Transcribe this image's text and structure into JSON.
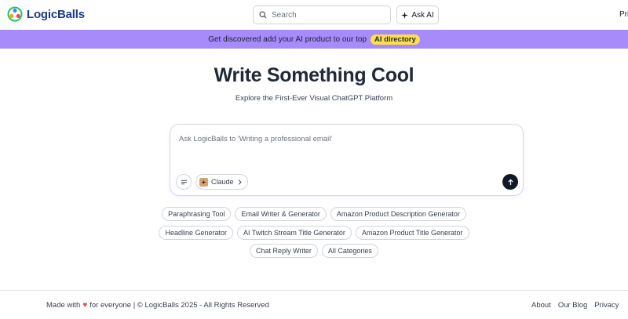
{
  "header": {
    "logo_text": "LogicBalls",
    "search_placeholder": "Search",
    "ask_ai_label": "Ask AI",
    "nav_cut_label": "Pri"
  },
  "banner": {
    "text": "Get discovered add your AI product to our top",
    "badge": "AI directory",
    "bg_color": "#a78bfa",
    "badge_color": "#fde047"
  },
  "hero": {
    "title": "Write Something Cool",
    "subtitle": "Explore the First-Ever Visual ChatGPT Platform"
  },
  "prompt": {
    "placeholder": "Ask LogicBalls to 'Writing a professional email'",
    "model_label": "Claude",
    "icons": [
      "sliders-icon",
      "claude-icon",
      "chevron-right-icon",
      "arrow-up-icon"
    ]
  },
  "chips": {
    "row1": [
      "Paraphrasing Tool",
      "Email Writer & Generator",
      "Amazon Product Description Generator"
    ],
    "row2": [
      "Headline Generator",
      "AI Twitch Stream Title Generator",
      "Amazon Product Title Generator"
    ],
    "row3": [
      "Chat Reply Writer",
      "All Categories"
    ]
  },
  "footer": {
    "made_with": "Made with",
    "for_everyone": "for everyone | © LogicBalls 2025 - All Rights Reserved",
    "links": [
      "About",
      "Our Blog",
      "Privacy"
    ]
  }
}
